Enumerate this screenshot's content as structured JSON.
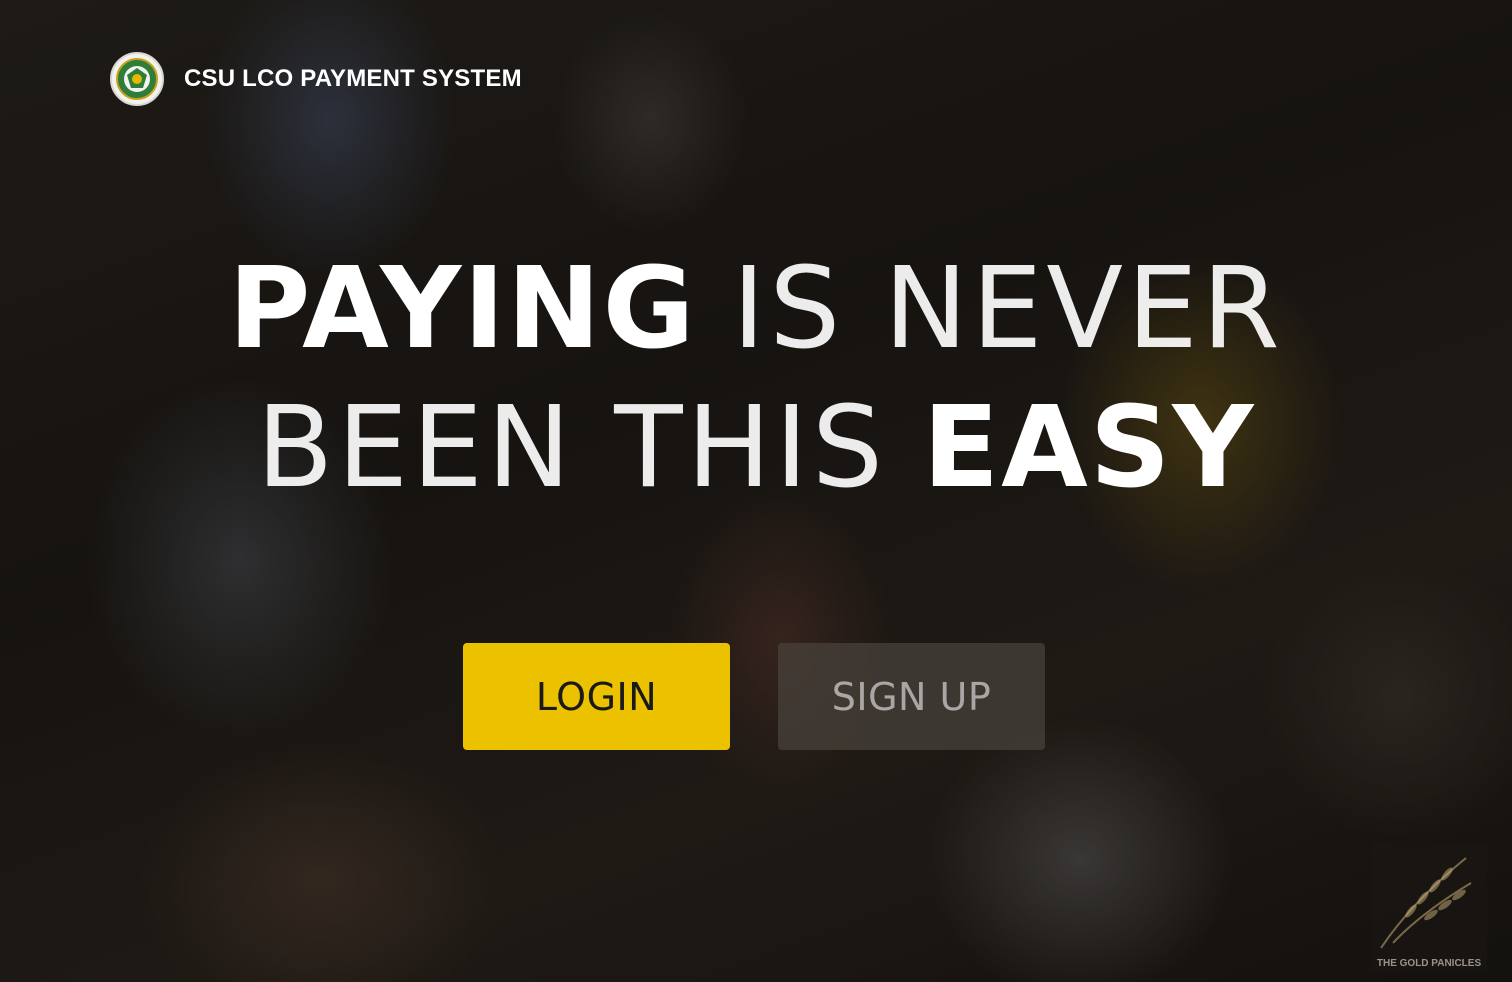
{
  "header": {
    "title": "CSU LCO PAYMENT SYSTEM",
    "logo_icon": "university-seal-icon"
  },
  "hero": {
    "line1_bold": "PAYING",
    "line1_thin": "IS NEVER",
    "line2_thin": "BEEN THIS",
    "line2_bold": "EASY"
  },
  "actions": {
    "login_label": "LOGIN",
    "signup_label": "SIGN UP"
  },
  "watermark": {
    "text": "THE GOLD PANICLES",
    "icon": "wheat-icon"
  },
  "colors": {
    "accent": "#ecc100",
    "text": "#ffffff",
    "signup_bg": "#46403a"
  }
}
